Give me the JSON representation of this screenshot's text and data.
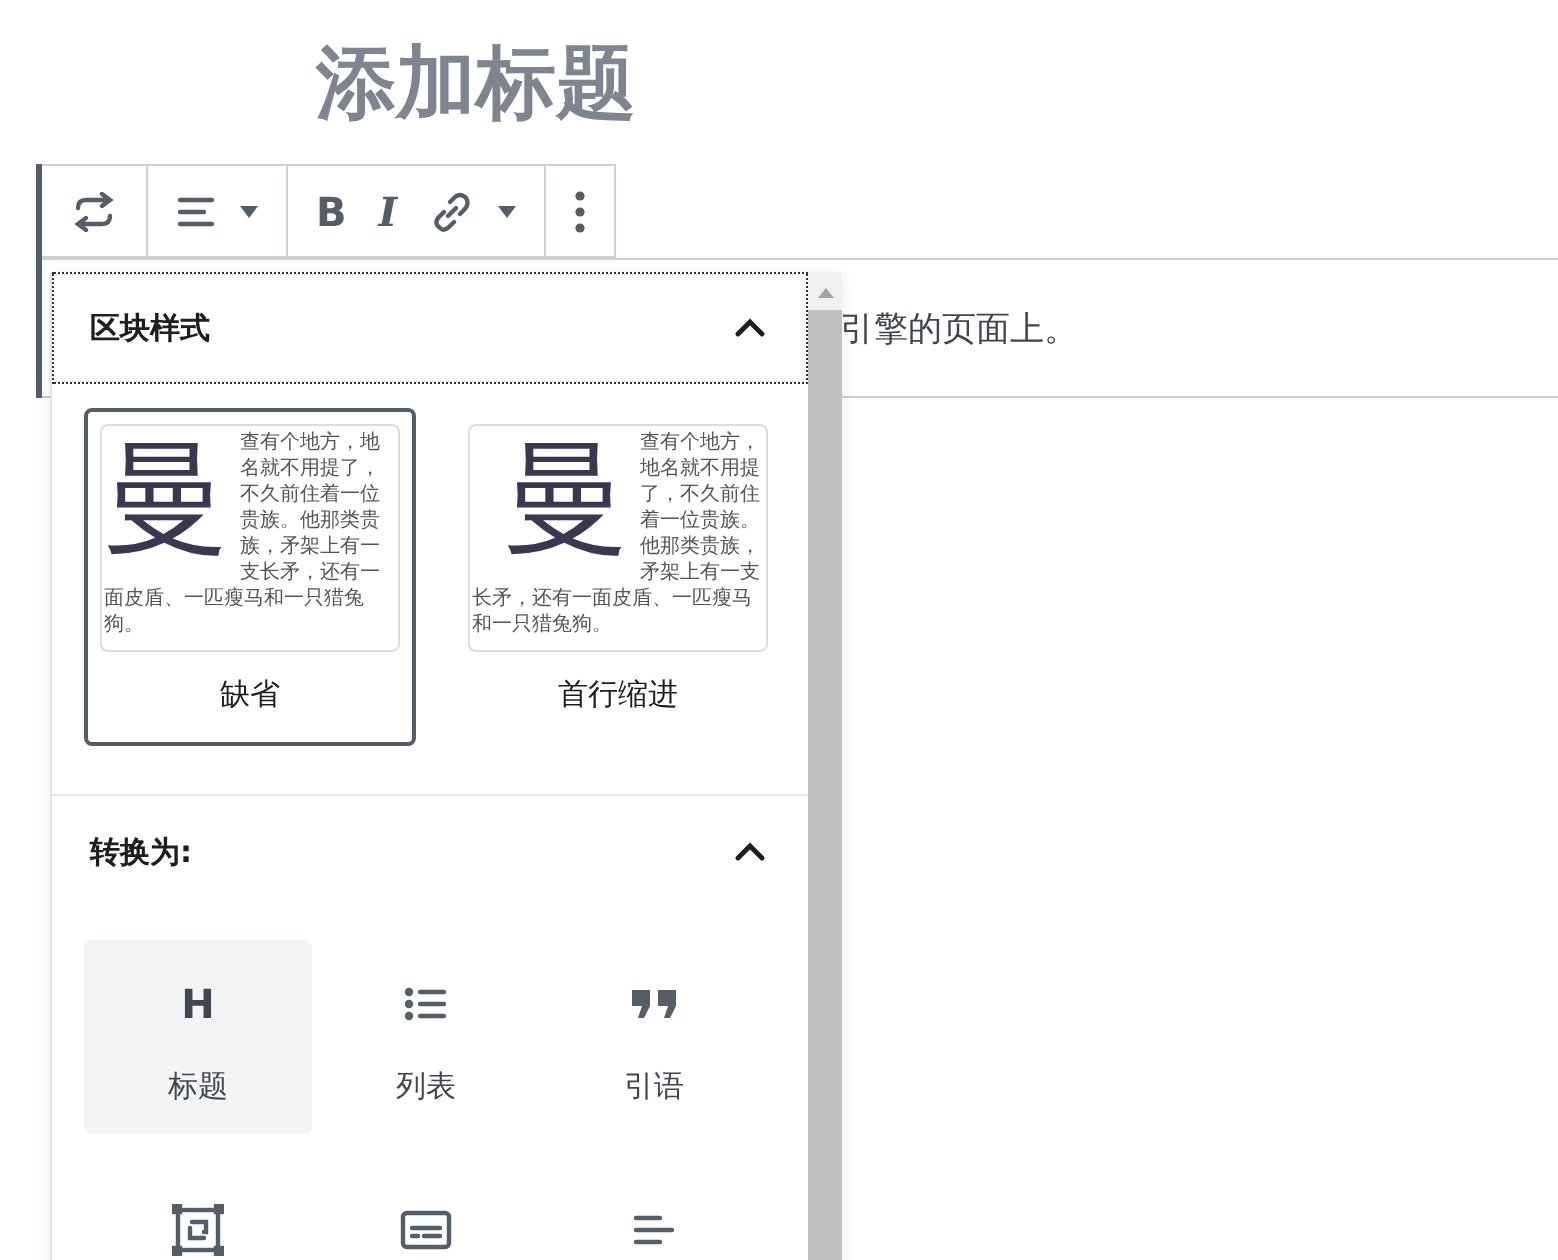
{
  "post_title": "添加标题",
  "toolbar": [
    {
      "buttons": [
        {
          "kind": "transform"
        }
      ]
    },
    {
      "buttons": [
        {
          "kind": "align"
        },
        {
          "kind": "caret"
        }
      ]
    },
    {
      "buttons": [
        {
          "kind": "bold",
          "label": "B"
        },
        {
          "kind": "italic",
          "label": "I"
        },
        {
          "kind": "link"
        },
        {
          "kind": "caret"
        }
      ]
    },
    {
      "buttons": [
        {
          "kind": "more"
        }
      ]
    }
  ],
  "paragraph": "引擎的页面上。",
  "popover": {
    "style_section": {
      "title": "区块样式",
      "expanded": true,
      "focused": true,
      "styles": [
        {
          "label": "缺省",
          "selected": true,
          "kind": "default",
          "drop_cap": "曼",
          "text": "查有个地方，地名就不用提了，不久前住着一位贵族。他那类贵族，矛架上有一支长矛，还有一面皮盾、一匹瘦马和一只猎兔狗。"
        },
        {
          "label": "首行缩进",
          "selected": false,
          "kind": "indent",
          "drop_cap": "曼",
          "text": "查有个地方，地名就不用提了，不久前住着一位贵族。他那类贵族，矛架上有一支长矛，还有一面皮盾、一匹瘦马和一只猎兔狗。"
        }
      ]
    },
    "transform_section": {
      "title": "转换为:",
      "expanded": true,
      "focused": false,
      "items": [
        {
          "kind": "heading",
          "glyph": "H",
          "label": "标题",
          "highlighted": true
        },
        {
          "kind": "list",
          "label": "列表",
          "highlighted": false
        },
        {
          "kind": "quote",
          "label": "引语",
          "highlighted": false
        },
        {
          "kind": "group",
          "highlighted": false
        },
        {
          "kind": "textbox",
          "highlighted": false
        },
        {
          "kind": "lines",
          "highlighted": false
        }
      ]
    }
  }
}
